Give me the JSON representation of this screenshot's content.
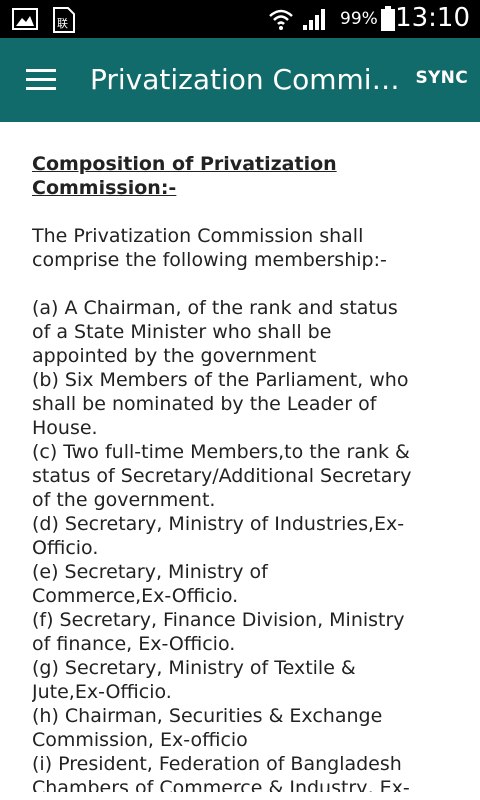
{
  "status_bar": {
    "battery": "99%",
    "time": "13:10",
    "icons": [
      "image-icon",
      "sim-icon",
      "wifi-icon",
      "signal-icon",
      "battery-icon"
    ]
  },
  "app_bar": {
    "title": "Privatization Commis...",
    "sync_label": "SYNC",
    "color": "#116b6a"
  },
  "content": {
    "heading": "Composition of Privatization Commission:-",
    "intro": "The Privatization Commission shall comprise the following membership:-",
    "items": [
      "(a)  A Chairman, of the rank and status of a State Minister who shall be appointed by the government",
      "(b)  Six Members of the Parliament, who shall be nominated by the Leader of House.",
      "(c)  Two full-time Members,to the rank & status of Secretary/Additional Secretary of the government.",
      "(d)  Secretary, Ministry of Industries,Ex-Officio.",
      "(e)  Secretary, Ministry of Commerce,Ex-Officio.",
      "(f)  Secretary, Finance Division, Ministry of finance, Ex-Officio.",
      "(g)  Secretary, Ministry of Textile & Jute,Ex-Officio.",
      "(h)  Chairman, Securities & Exchange Commission, Ex-officio",
      "(i)  President, Federation of Bangladesh Chambers of Commerce & Industry, Ex-Officio."
    ]
  }
}
